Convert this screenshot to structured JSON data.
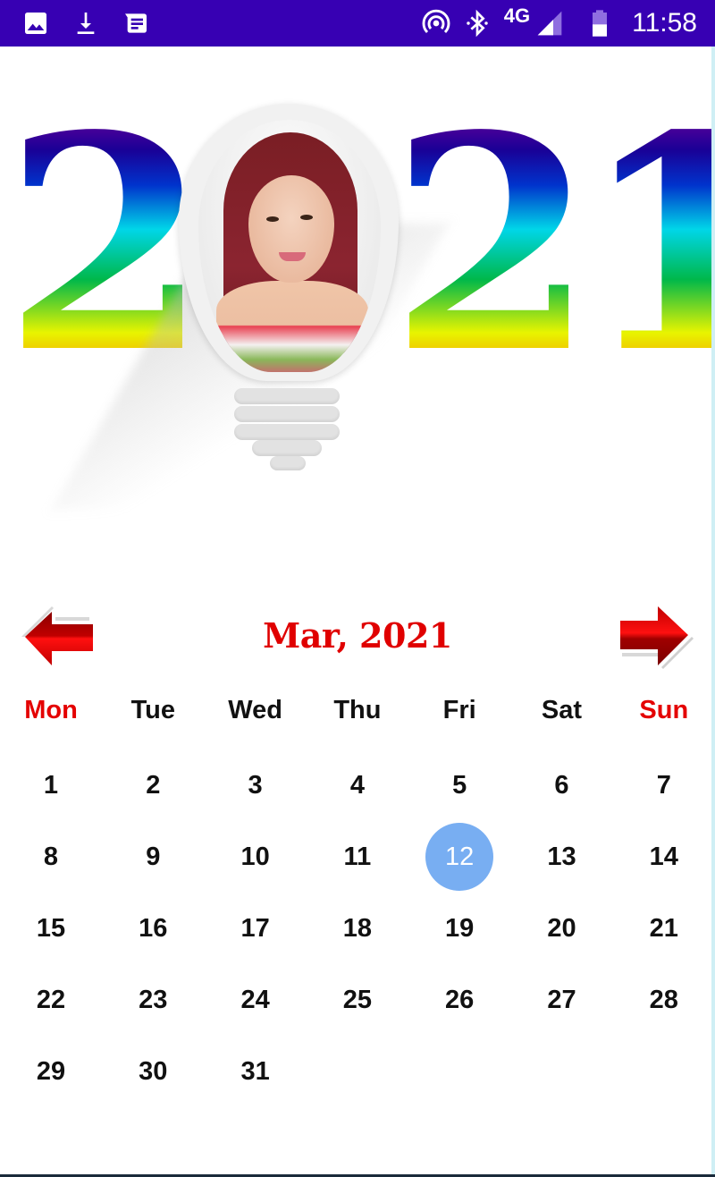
{
  "status_bar": {
    "left_icons": [
      "image-icon",
      "download-icon",
      "message-icon"
    ],
    "right_icons": [
      "hotspot-icon",
      "bluetooth-icon",
      "signal-icon",
      "battery-icon"
    ],
    "network": "4G",
    "time": "11:58",
    "background": "#3700b3"
  },
  "header": {
    "year_digits": [
      "2",
      "0",
      "2",
      "1"
    ],
    "photo_alt": "Portrait photo inside light bulb"
  },
  "calendar": {
    "title": "Mar, 2021",
    "prev_label": "Previous month",
    "next_label": "Next month",
    "weekdays": [
      {
        "label": "Mon",
        "highlight": true
      },
      {
        "label": "Tue",
        "highlight": false
      },
      {
        "label": "Wed",
        "highlight": false
      },
      {
        "label": "Thu",
        "highlight": false
      },
      {
        "label": "Fri",
        "highlight": false
      },
      {
        "label": "Sat",
        "highlight": false
      },
      {
        "label": "Sun",
        "highlight": true
      }
    ],
    "first_weekday_index": 0,
    "days_in_month": 31,
    "today": 12,
    "days": [
      "1",
      "2",
      "3",
      "4",
      "5",
      "6",
      "7",
      "8",
      "9",
      "10",
      "11",
      "12",
      "13",
      "14",
      "15",
      "16",
      "17",
      "18",
      "19",
      "20",
      "21",
      "22",
      "23",
      "24",
      "25",
      "26",
      "27",
      "28",
      "29",
      "30",
      "31"
    ],
    "colors": {
      "title": "#e00000",
      "weekend_label": "#e40000",
      "today_circle": "#78aef2"
    }
  }
}
